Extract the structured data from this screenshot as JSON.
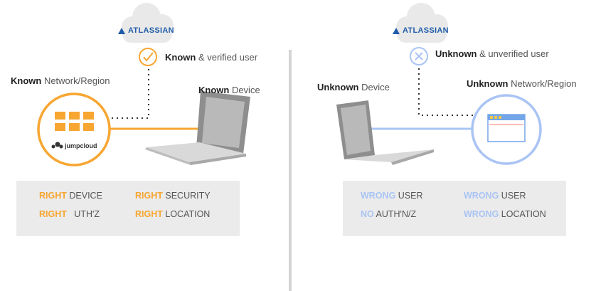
{
  "left": {
    "brand": "ATLASSIAN",
    "user_kw": "Known",
    "user_rest": " & verified user",
    "network_kw": "Known",
    "network_rest": " Network/Region",
    "device_kw": "Known",
    "device_rest": " Device",
    "logo": "jumpcloud",
    "status": [
      {
        "kw": "RIGHT",
        "rest": " DEVICE"
      },
      {
        "kw": "RIGHT",
        "rest": " SECURITY"
      },
      {
        "kw": "RIGHT",
        "rest": "   UTH'Z"
      },
      {
        "kw": "RIGHT",
        "rest": " LOCATION"
      }
    ]
  },
  "right": {
    "brand": "ATLASSIAN",
    "user_kw": "Unknown",
    "user_rest": " & unverified user",
    "device_kw": "Unknown",
    "device_rest": " Device",
    "network_kw": "Unknown",
    "network_rest": " Network/Region",
    "status": [
      {
        "kw": "WRONG",
        "rest": " USER"
      },
      {
        "kw": "WRONG",
        "rest": " USER"
      },
      {
        "kw": "NO",
        "rest": " AUTH'N/Z"
      },
      {
        "kw": "WRONG",
        "rest": " LOCATION"
      }
    ]
  },
  "colors": {
    "accent_left": "#f7a632",
    "accent_right": "#a9c4f4",
    "brand": "#1f5ba8"
  }
}
